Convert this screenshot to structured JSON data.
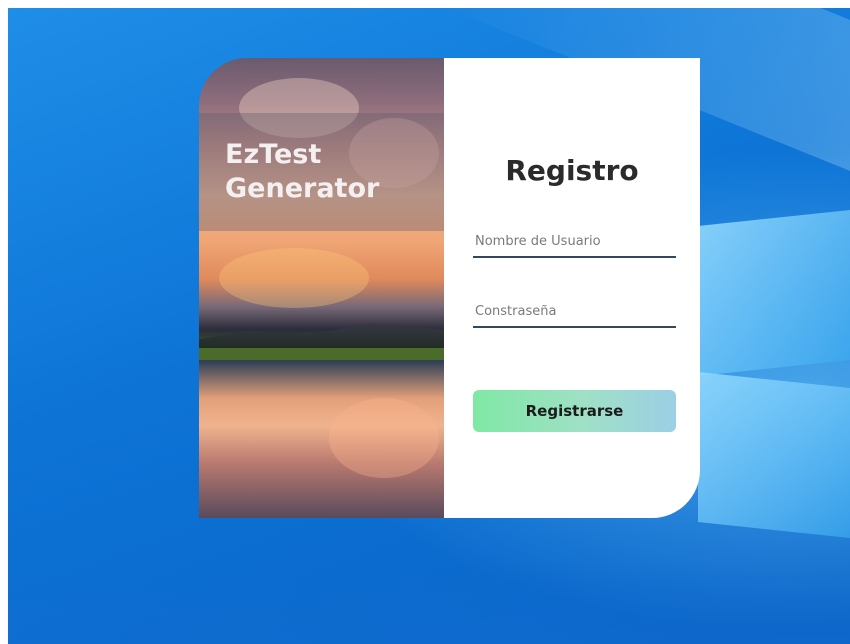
{
  "app": {
    "title_line1": "EzTest",
    "title_line2": "Generator"
  },
  "form": {
    "heading": "Registro",
    "username_placeholder": "Nombre de Usuario",
    "username_value": "",
    "password_placeholder": "Constraseña",
    "password_value": "",
    "submit_label": "Registrarse"
  },
  "colors": {
    "button_start": "#7fe8a4",
    "button_end": "#9ccfe6",
    "field_underline": "#34495e",
    "heading": "#2b2b2b"
  }
}
